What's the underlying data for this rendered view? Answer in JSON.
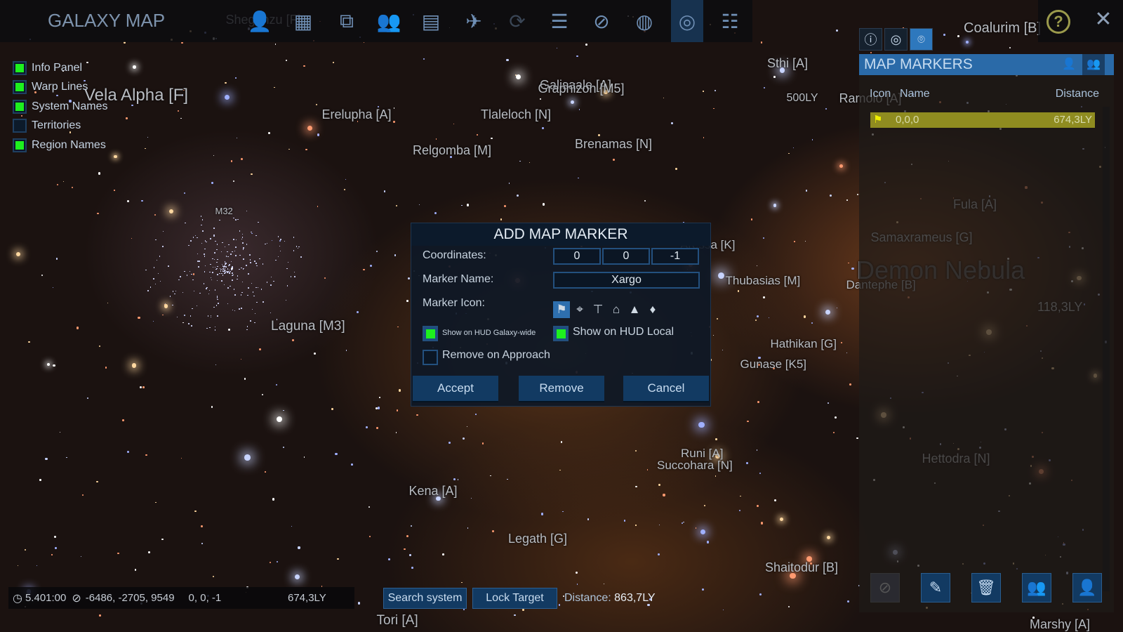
{
  "header": {
    "title": "GALAXY MAP"
  },
  "toolbar": {
    "icons": [
      "character-icon",
      "logistics-icon",
      "hierarchy-icon",
      "crew-icon",
      "window-icon",
      "ship-icon",
      "refresh-icon",
      "list-icon",
      "compass-icon",
      "planet-icon",
      "galaxy-icon",
      "settings-sliders-icon"
    ],
    "active": "galaxy-icon"
  },
  "layers": [
    {
      "label": "Info Panel",
      "checked": true
    },
    {
      "label": "Warp Lines",
      "checked": true
    },
    {
      "label": "System Names",
      "checked": true
    },
    {
      "label": "Territories",
      "checked": false
    },
    {
      "label": "Region Names",
      "checked": true
    }
  ],
  "map_labels": [
    "Sheganzu [F]",
    "Vela Alpha [F]",
    "Erelupha [A]",
    "Galisaale [A]",
    "Graphizon [M5]",
    "Tlaleloch [N]",
    "Sthi [A]",
    "500LY",
    "Ramolo [A]",
    "Coalurim [B]",
    "Relgomba [M]",
    "Brenamas [N]",
    "M32",
    "Fula [A]",
    "Samaxrameus [G]",
    "Demon Nebula",
    "Dantephe [B]",
    "118,3LY",
    "Aressa [K]",
    "Thubasias [M]",
    "Laguna [M3]",
    "Hathikan [G]",
    "Gunase [K5]",
    "Runi [A]",
    "Succohara [N]",
    "Hettodra [N]",
    "Kena [A]",
    "Legath [G]",
    "Shaitodur [B]",
    "Tori [A]",
    "Marshy [A]"
  ],
  "panel": {
    "tabs": [
      "info-icon",
      "target-icon",
      "map-marker-icon"
    ],
    "title": "MAP MARKERS",
    "columns": {
      "icon": "Icon",
      "name": "Name",
      "distance": "Distance"
    },
    "markers": [
      {
        "icon": "flag-icon",
        "name": "0,0,0",
        "distance": "674,3LY"
      }
    ],
    "buttons": [
      "navigate-icon",
      "edit-icon",
      "trash-icon",
      "group-icon",
      "user-icon"
    ]
  },
  "dialog": {
    "title": "ADD MAP MARKER",
    "coordinates_label": "Coordinates:",
    "coordinates": [
      "0",
      "0",
      "-1"
    ],
    "name_label": "Marker Name:",
    "name_value": "Xargo",
    "icon_label": "Marker Icon:",
    "icons": [
      "flag-icon",
      "crosshair-icon",
      "pin-icon",
      "home-icon",
      "ship-icon",
      "crystal-icon"
    ],
    "selected_icon": "flag-icon",
    "hud_galaxy": {
      "label": "Show on HUD Galaxy-wide",
      "checked": true
    },
    "hud_local": {
      "label": "Show on HUD Local",
      "checked": true
    },
    "remove_approach": {
      "label": "Remove on Approach",
      "checked": false
    },
    "accept": "Accept",
    "remove": "Remove",
    "cancel": "Cancel"
  },
  "status": {
    "time": "5.401:00",
    "position": "-6486, -2705, 9549",
    "target": "0, 0, -1",
    "distance": "674,3LY"
  },
  "bottom": {
    "search": "Search system",
    "lock": "Lock Target",
    "distance_label": "Distance:",
    "distance_value": "863,7LY"
  },
  "colors": {
    "accent": "#2a6aa8",
    "check": "#1ef01e",
    "marker_row": "#8f8c20"
  }
}
